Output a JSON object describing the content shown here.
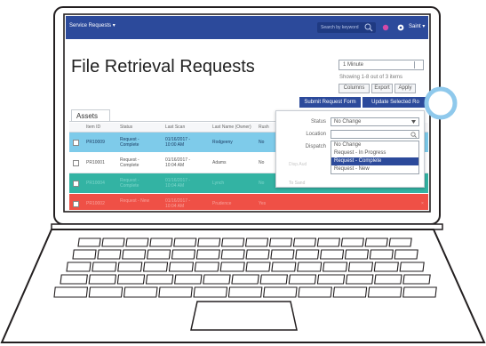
{
  "app": {
    "menu_title": "Service Requests ▾",
    "search_placeholder": "Search by keyword",
    "user_menu": "Saint ▾"
  },
  "page": {
    "title": "File Retrieval Requests",
    "range_value": "1 Minute",
    "showing_text": "Showing 1-8 out of 3 items"
  },
  "toolbar": {
    "columns_label": "Columns",
    "export_label": "Export",
    "apply_label": "Apply",
    "submit_label": "Submit Request Form",
    "update_label": "Update Selected Ro"
  },
  "tabs": [
    {
      "label": "Assets"
    }
  ],
  "table": {
    "headers": [
      "Item ID",
      "Status",
      "Last Scan",
      "Last Name (Owner)",
      "Rush"
    ],
    "rows": [
      {
        "id": "PR10009",
        "status": "Request - Complete",
        "scan": "01/16/2017 - 10:00 AM",
        "owner": "Rodgeeny",
        "rush": "No"
      },
      {
        "id": "PR10001",
        "status": "Request - Complete",
        "scan": "01/16/2017 - 10:04 AM",
        "owner": "Adams",
        "rush": "No"
      },
      {
        "id": "PR10004",
        "status": "Request - Complete",
        "scan": "01/16/2017 - 10:04 AM",
        "owner": "Lynch",
        "rush": "No"
      },
      {
        "id": "PR10002",
        "status": "Request - New",
        "scan": "01/16/2017 - 10:04 AM",
        "owner": "Prudence",
        "rush": "Yes"
      }
    ]
  },
  "popover": {
    "status_label": "Status",
    "status_value": "No Change",
    "location_label": "Location",
    "dispatch_label": "Dispatch",
    "options": [
      "No Change",
      "Request - In Progress",
      "Request - Complete",
      "Request - New"
    ],
    "selected_option": "Request - Complete",
    "behind_texts": [
      "Disp.Aud",
      "To Sand"
    ]
  },
  "colors": {
    "nav_blue": "#2c4a9b",
    "row_selected_blue": "#7ecbea",
    "row_green": "#33b3a3",
    "row_red": "#ef5046",
    "cursor_ring": "#8fc9ec"
  },
  "icons": {
    "search": "magnifier-icon",
    "settings": "gear-icon",
    "notifications": "dot-icon"
  }
}
